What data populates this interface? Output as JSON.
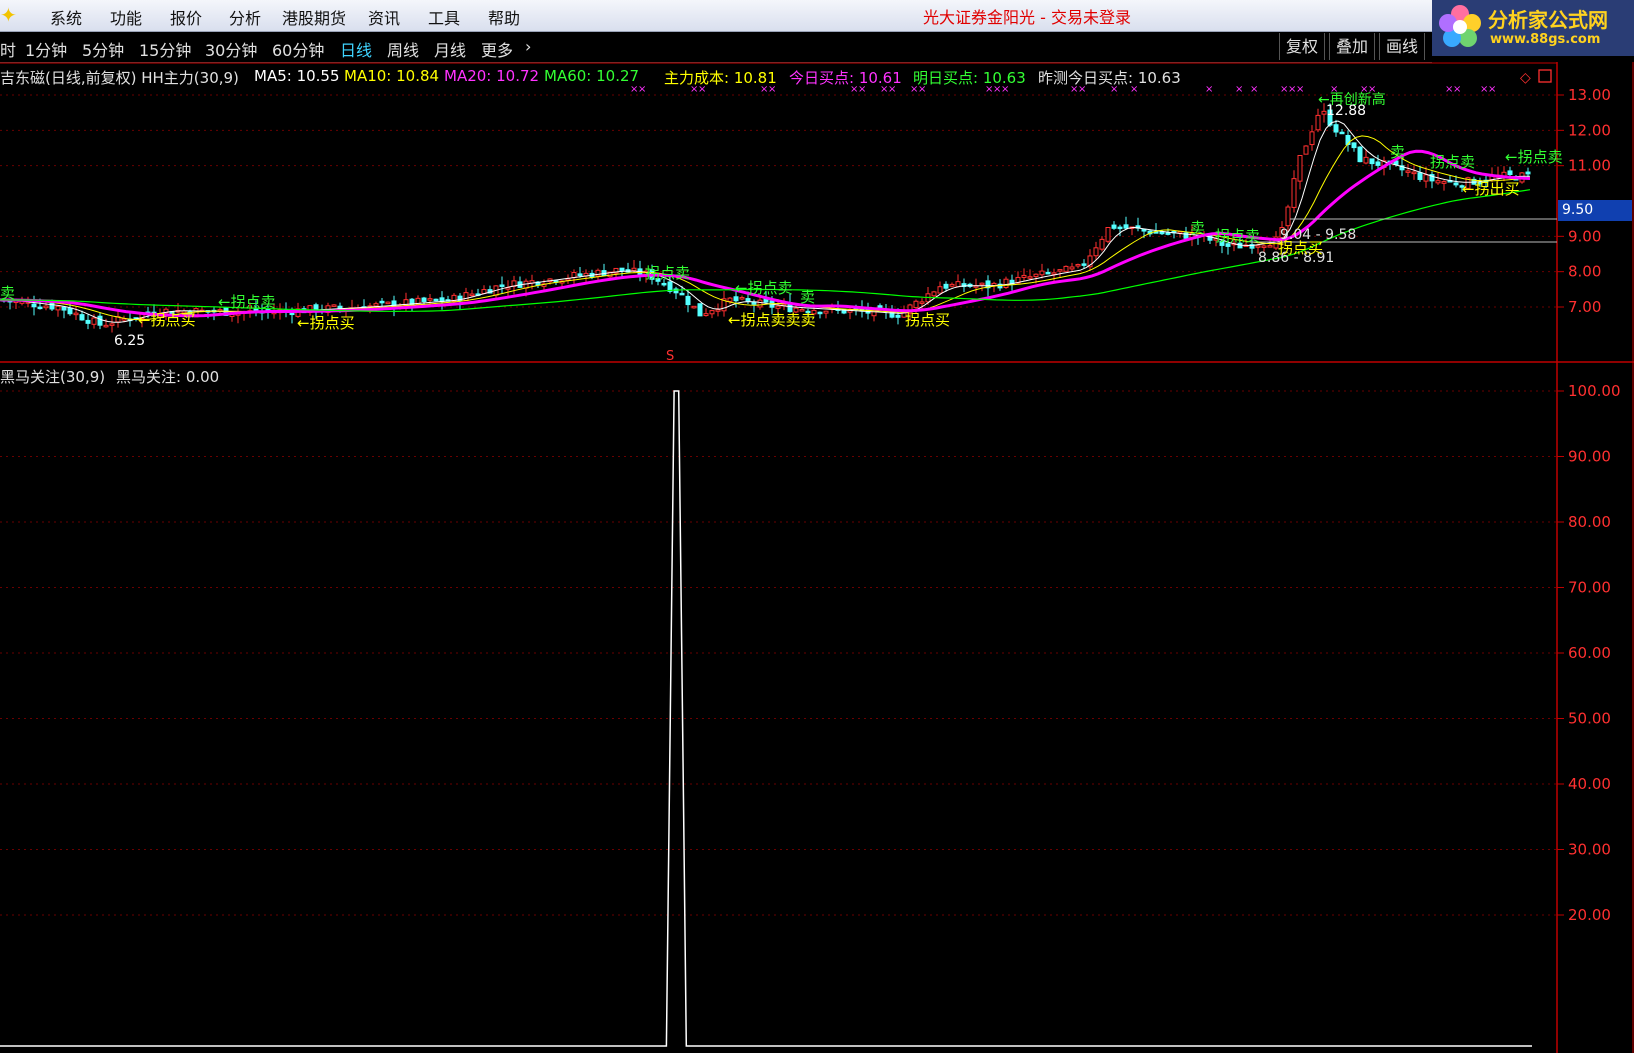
{
  "menubar": {
    "app_icon": "sparkle-icon",
    "items": [
      "系统",
      "功能",
      "报价",
      "分析",
      "港股期货",
      "资讯",
      "工具",
      "帮助"
    ],
    "window_title": "光大证券金阳光 - 交易未登录"
  },
  "logo": {
    "text": "分析家公式网",
    "url": "www.88gs.com"
  },
  "toolbar": {
    "periods": [
      "时",
      "1分钟",
      "5分钟",
      "15分钟",
      "30分钟",
      "60分钟",
      "日线",
      "周线",
      "月线",
      "更多"
    ],
    "active_period": "日线",
    "more_icon": "chevron-right-icon",
    "buttons": [
      "复权",
      "叠加",
      "画线"
    ]
  },
  "main_info": {
    "title": "吉东磁(日线,前复权) HH主力(30,9)",
    "ma5": "MA5: 10.55",
    "ma10": "MA10: 10.84",
    "ma20": "MA20: 10.72",
    "ma60": "MA60: 10.27",
    "cost": "主力成本: 10.81",
    "today_buy": "今日买点: 10.61",
    "tomorrow_buy": "明日买点: 10.63",
    "predict": "昨测今日买点: 10.63"
  },
  "main_axis": [
    "13.00",
    "12.00",
    "11.00",
    "9.00",
    "8.00",
    "7.00"
  ],
  "current_price_label": "9.50",
  "annotations": {
    "high": "12.88",
    "low": "6.25",
    "range_1": "9.04 - 9.58",
    "range_2": "8.86 - 8.91",
    "new_high": "←再创新高",
    "turn_sell": "拐点卖",
    "turn_buy": "拐点买",
    "turn_sell_arrow": "←拐点卖",
    "turn_buy_arrow": "←拐点买",
    "sell": "卖",
    "s_marker": "S",
    "mixed": "←拐点卖卖卖",
    "exit_buy": "←拐出买"
  },
  "sub_info": {
    "title": "黑马关注(30,9)",
    "value": "黑马关注: 0.00"
  },
  "sub_axis": [
    "100.00",
    "90.00",
    "80.00",
    "70.00",
    "60.00",
    "50.00",
    "40.00",
    "30.00",
    "20.00"
  ],
  "indicator_series": {
    "name": "黑马关注",
    "x": [
      0,
      0.435,
      0.437,
      0.44,
      0.443,
      0.446,
      0.448,
      1
    ],
    "y": [
      0,
      0,
      40,
      100,
      100,
      40,
      0,
      0
    ],
    "ylim": [
      0,
      100
    ]
  },
  "colors": {
    "ma5": "#ffffff",
    "ma10": "#ffff00",
    "ma20": "#ff00ff",
    "ma60": "#00ff00",
    "up": "#ff3030",
    "down": "#55ffff",
    "grid": "#8b0000",
    "cost": "#ffff00",
    "today_buy": "#ff00ff",
    "tomorrow_buy": "#00ff00"
  }
}
